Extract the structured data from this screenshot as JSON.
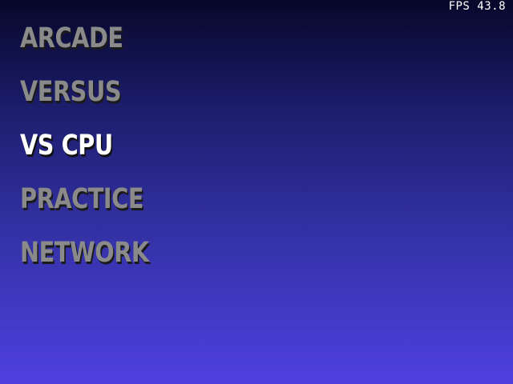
{
  "hud": {
    "fps_label": "FPS 43.8"
  },
  "menu": {
    "selected_index": 2,
    "items": [
      {
        "label": "ARCADE",
        "selected": false
      },
      {
        "label": "VERSUS",
        "selected": false
      },
      {
        "label": "VS CPU",
        "selected": true
      },
      {
        "label": "PRACTICE",
        "selected": false
      },
      {
        "label": "NETWORK",
        "selected": false
      }
    ]
  },
  "colors": {
    "background_top": "#07072a",
    "background_bottom": "#4e40e0",
    "item_normal": "#8a8a8a",
    "item_selected": "#ffffff"
  }
}
